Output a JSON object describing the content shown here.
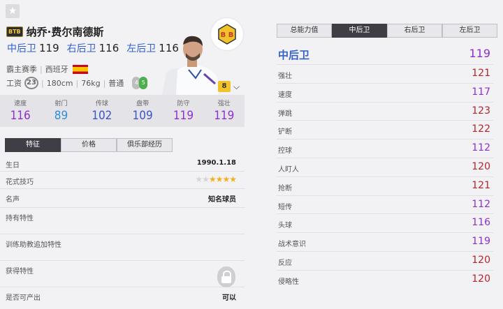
{
  "player": {
    "season_badge": "BTB",
    "name": "纳乔·费尔南德斯",
    "positions": [
      {
        "label": "中后卫",
        "value": "119"
      },
      {
        "label": "右后卫",
        "value": "116"
      },
      {
        "label": "左后卫",
        "value": "116"
      }
    ],
    "club": "霸主赛季",
    "nation": "西班牙",
    "wage_label": "工资",
    "wage": "23",
    "height": "180cm",
    "weight": "76kg",
    "body_type": "普通",
    "weak_foot": "4",
    "strong_foot": "5",
    "club_logo_text": "B B",
    "level": "8"
  },
  "stats": [
    {
      "label": "速度",
      "value": "116",
      "color": "#8e2fcd"
    },
    {
      "label": "射门",
      "value": "89",
      "color": "#2e8fd6"
    },
    {
      "label": "传球",
      "value": "102",
      "color": "#3d55c4"
    },
    {
      "label": "盘带",
      "value": "109",
      "color": "#3d55c4"
    },
    {
      "label": "防守",
      "value": "119",
      "color": "#8e2fcd"
    },
    {
      "label": "强壮",
      "value": "119",
      "color": "#8e2fcd"
    }
  ],
  "left_tabs": [
    "特征",
    "价格",
    "俱乐部经历"
  ],
  "details": {
    "birthday": {
      "label": "生日",
      "value": "1990.1.18"
    },
    "skill_moves": {
      "label": "花式技巧",
      "stars": 4,
      "max": 6
    },
    "reputation": {
      "label": "名声",
      "value": "知名球员"
    },
    "traits": {
      "label": "持有特性"
    },
    "coach_traits": {
      "label": "训练助教追加特性"
    },
    "acquired_traits": {
      "label": "获得特性"
    },
    "producible": {
      "label": "是否可产出",
      "value": "可以"
    }
  },
  "right_tabs": [
    "总能力值",
    "中后卫",
    "右后卫",
    "左后卫"
  ],
  "position_detail": {
    "title": "中后卫",
    "total": "119",
    "attributes": [
      {
        "label": "强壮",
        "value": "121",
        "color": "#b8232b"
      },
      {
        "label": "速度",
        "value": "117",
        "color": "#8e2fcd"
      },
      {
        "label": "弹跳",
        "value": "123",
        "color": "#b8232b"
      },
      {
        "label": "铲断",
        "value": "122",
        "color": "#b8232b"
      },
      {
        "label": "控球",
        "value": "112",
        "color": "#8e2fcd"
      },
      {
        "label": "人盯人",
        "value": "120",
        "color": "#b8232b"
      },
      {
        "label": "抢断",
        "value": "121",
        "color": "#b8232b"
      },
      {
        "label": "短传",
        "value": "112",
        "color": "#8e2fcd"
      },
      {
        "label": "头球",
        "value": "116",
        "color": "#8e2fcd"
      },
      {
        "label": "战术意识",
        "value": "119",
        "color": "#8e2fcd"
      },
      {
        "label": "反应",
        "value": "120",
        "color": "#b8232b"
      },
      {
        "label": "侵略性",
        "value": "120",
        "color": "#b8232b"
      }
    ]
  }
}
